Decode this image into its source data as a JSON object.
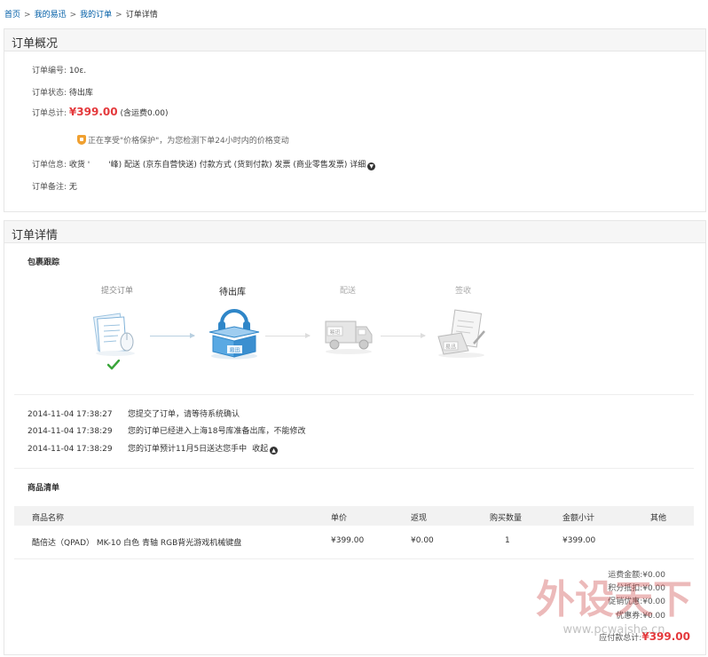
{
  "breadcrumb": {
    "items": [
      "首页",
      "我的易迅",
      "我的订单",
      "订单详情"
    ],
    "sep": ">"
  },
  "overview": {
    "title": "订单概况",
    "order_no_label": "订单编号:",
    "order_no": "10ε.",
    "status_label": "订单状态:",
    "status": "待出库",
    "total_label": "订单总计:",
    "total": "¥399.00",
    "shipping_note": "(含运费0.00)",
    "price_protect": "正在享受\"价格保护\"，为您检测下单24小时内的价格变动",
    "info_label": "订单信息:",
    "info_text": "收货 '   '峰) 配送 (京东自营快送) 付款方式 (货到付款) 发票 (商业零售发票) 详细",
    "remark_label": "订单备注:",
    "remark": "无"
  },
  "detail": {
    "title": "订单详情",
    "tracking_title": "包裹跟踪",
    "steps": [
      {
        "label": "提交订单",
        "state": "done"
      },
      {
        "label": "待出库",
        "state": "current"
      },
      {
        "label": "配送",
        "state": "todo"
      },
      {
        "label": "签收",
        "state": "todo"
      }
    ],
    "logs": [
      {
        "time": "2014-11-04 17:38:27",
        "text": "您提交了订单，请等待系统确认"
      },
      {
        "time": "2014-11-04 17:38:29",
        "text": "您的订单已经进入上海18号库准备出库，不能修改"
      },
      {
        "time": "2014-11-04 17:38:29",
        "text": "您的订单预计11月5日送达您手中"
      }
    ],
    "collapse_label": "收起",
    "items_title": "商品清单",
    "columns": [
      "商品名称",
      "单价",
      "返现",
      "购买数量",
      "金额小计",
      "其他"
    ],
    "rows": [
      {
        "name": "酷倍达（QPAD） MK-10 白色 青轴 RGB背光游戏机械键盘",
        "price": "¥399.00",
        "cashback": "¥0.00",
        "qty": "1",
        "subtotal": "¥399.00",
        "other": ""
      }
    ],
    "summary": [
      {
        "label": "运费金额:",
        "value": "¥0.00"
      },
      {
        "label": "积分抵扣:",
        "value": "¥0.00"
      },
      {
        "label": "促销优惠:",
        "value": "¥0.00"
      },
      {
        "label": "优惠券:",
        "value": "¥0.00"
      }
    ],
    "payable_label": "应付款总计:",
    "payable": "¥399.00"
  },
  "watermark": {
    "text_cn": "外设天下",
    "url": "www.pcwaishe.cn"
  },
  "colors": {
    "price_red": "#e4393c",
    "link_blue": "#005ea7",
    "check_green": "#3aa53a"
  }
}
